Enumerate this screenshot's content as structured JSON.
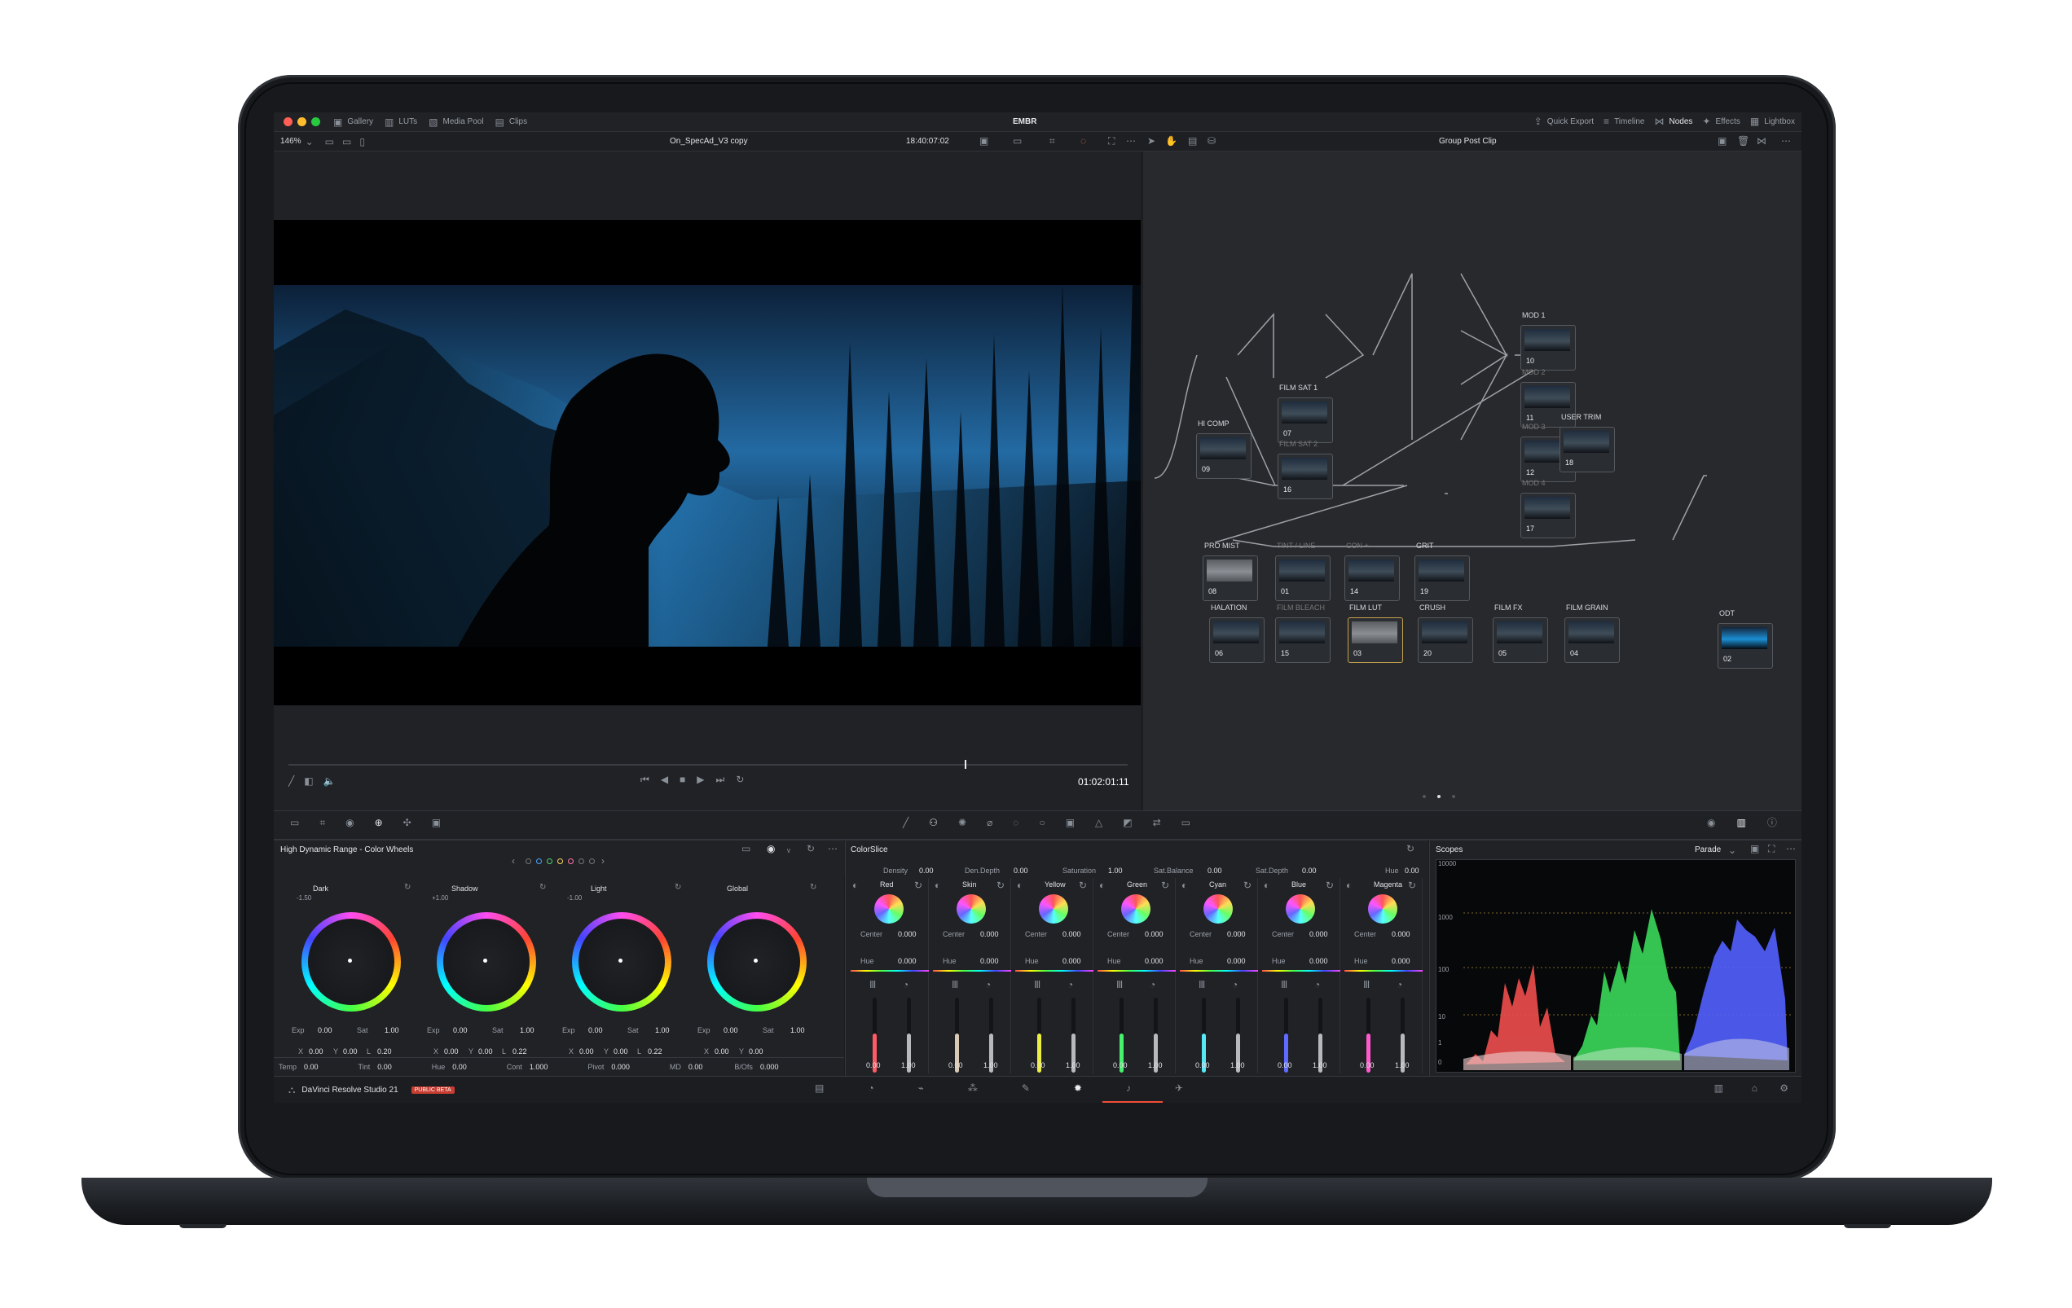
{
  "app": {
    "title": "EMBR",
    "brand": "DaVinci Resolve Studio 21",
    "beta": "PUBLIC BETA",
    "top_tabs": [
      "Gallery",
      "LUTs",
      "Media Pool",
      "Clips"
    ],
    "right_tabs": [
      "Quick Export",
      "Timeline",
      "Nodes",
      "Effects",
      "Lightbox"
    ]
  },
  "viewer": {
    "zoom": "146%",
    "clip_name": "On_SpecAd_V3 copy",
    "timecode_top": "18:40:07:02",
    "timecode_bottom": "01:02:01:11"
  },
  "nodes": {
    "title": "Group Post Clip",
    "items": [
      {
        "label": "MOD 1",
        "num": "10"
      },
      {
        "label": "MOD 2",
        "num": "11"
      },
      {
        "label": "MOD 3",
        "num": "12"
      },
      {
        "label": "MOD 4",
        "num": "17"
      },
      {
        "label": "FILM SAT 1",
        "num": "07"
      },
      {
        "label": "FILM SAT 2",
        "num": "16"
      },
      {
        "label": "HI COMP",
        "num": "09"
      },
      {
        "label": "USER TRIM",
        "num": "18"
      },
      {
        "label": "PRO MIST",
        "num": "08"
      },
      {
        "label": "TINT / LINE",
        "num": "01"
      },
      {
        "label": "CON +",
        "num": "14"
      },
      {
        "label": "GRIT",
        "num": "19"
      },
      {
        "label": "HALATION",
        "num": "06"
      },
      {
        "label": "FILM BLEACH",
        "num": "15"
      },
      {
        "label": "FILM LUT",
        "num": "03"
      },
      {
        "label": "CRUSH",
        "num": "20"
      },
      {
        "label": "FILM FX",
        "num": "05"
      },
      {
        "label": "FILM GRAIN",
        "num": "04"
      },
      {
        "label": "ODT",
        "num": "02"
      }
    ]
  },
  "color_wheels": {
    "title": "High Dynamic Range - Color Wheels",
    "wheels": [
      {
        "name": "Dark",
        "badge": "-1.50",
        "exp": "0.00",
        "sat": "1.00",
        "x": "0.00",
        "y": "0.00",
        "z": "0.20"
      },
      {
        "name": "Shadow",
        "badge": "+1.00",
        "exp": "0.00",
        "sat": "1.00",
        "x": "0.00",
        "y": "0.00",
        "z": "0.22"
      },
      {
        "name": "Light",
        "badge": "-1.00",
        "exp": "0.00",
        "sat": "1.00",
        "x": "0.00",
        "y": "0.00",
        "z": "0.22"
      },
      {
        "name": "Global",
        "badge": "",
        "exp": "0.00",
        "sat": "1.00",
        "x": "0.00",
        "y": "0.00",
        "z": ""
      }
    ],
    "bottom": [
      {
        "label": "Temp",
        "value": "0.00"
      },
      {
        "label": "Tint",
        "value": "0.00"
      },
      {
        "label": "Hue",
        "value": "0.00"
      },
      {
        "label": "Cont",
        "value": "1.000"
      },
      {
        "label": "Pivot",
        "value": "0.000"
      },
      {
        "label": "MD",
        "value": "0.00"
      },
      {
        "label": "B/Ofs",
        "value": "0.000"
      }
    ]
  },
  "colorslice": {
    "title": "ColorSlice",
    "params": [
      {
        "label": "Density",
        "value": "0.00"
      },
      {
        "label": "Den.Depth",
        "value": "0.00"
      },
      {
        "label": "Saturation",
        "value": "1.00"
      },
      {
        "label": "Sat.Balance",
        "value": "0.00"
      },
      {
        "label": "Sat.Depth",
        "value": "0.00"
      },
      {
        "label": "Hue",
        "value": "0.00"
      }
    ],
    "channels": [
      {
        "name": "Red",
        "center": "0.000",
        "hue": "0.000",
        "left": "0.00",
        "right": "1.00",
        "color": "#ff5b65"
      },
      {
        "name": "Skin",
        "center": "0.000",
        "hue": "0.000",
        "left": "0.00",
        "right": "1.00",
        "color": "#d8cab5"
      },
      {
        "name": "Yellow",
        "center": "0.000",
        "hue": "0.000",
        "left": "0.00",
        "right": "1.00",
        "color": "#ecef42"
      },
      {
        "name": "Green",
        "center": "0.000",
        "hue": "0.000",
        "left": "0.00",
        "right": "1.00",
        "color": "#47f06d"
      },
      {
        "name": "Cyan",
        "center": "0.000",
        "hue": "0.000",
        "left": "0.00",
        "right": "1.00",
        "color": "#55e8f5"
      },
      {
        "name": "Blue",
        "center": "0.000",
        "hue": "0.000",
        "left": "0.00",
        "right": "1.00",
        "color": "#5f6bff"
      },
      {
        "name": "Magenta",
        "center": "0.000",
        "hue": "0.000",
        "left": "0.00",
        "right": "1.00",
        "color": "#ff59cb"
      }
    ]
  },
  "scopes": {
    "title": "Scopes",
    "mode": "Parade",
    "axis": [
      "10000",
      "1000",
      "100",
      "10",
      "1",
      "0"
    ]
  }
}
